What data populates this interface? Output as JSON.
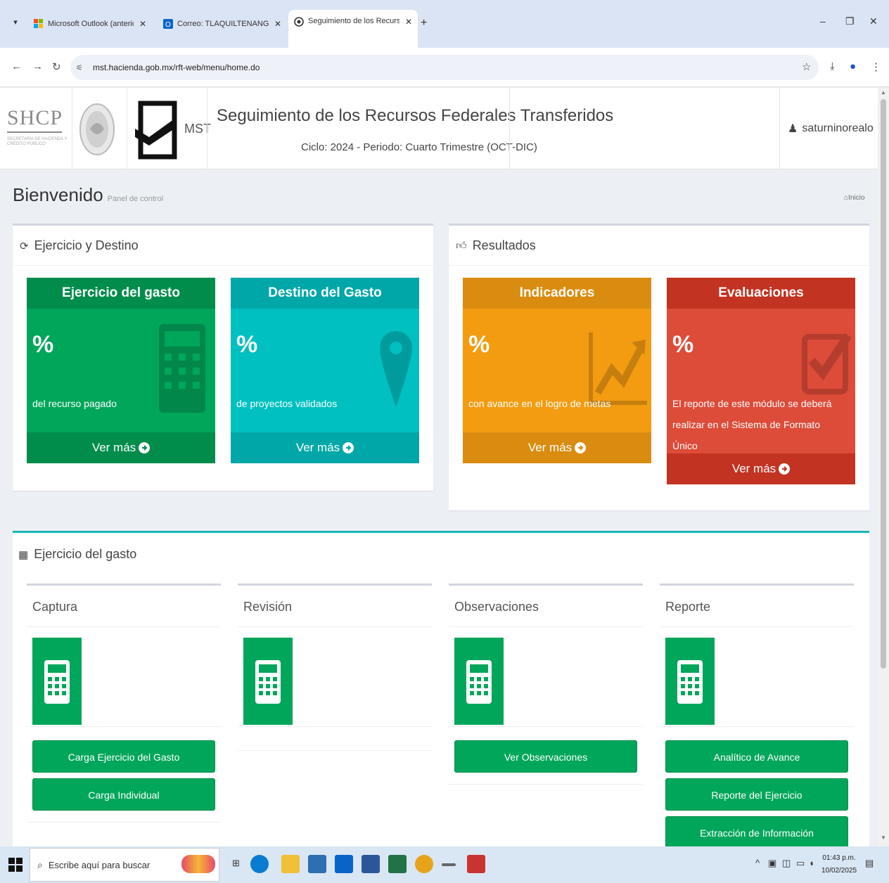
{
  "browser": {
    "tabs": [
      {
        "title": "Microsoft Outlook (anteriorme"
      },
      {
        "title": "Correo: TLAQUILTENANGO MC"
      },
      {
        "title": "Seguimiento de los Recursos F"
      }
    ],
    "url": "mst.hacienda.gob.mx/rft-web/menu/home.do"
  },
  "header": {
    "org_logo": "SHCP",
    "org_logo_sub": "SECRETARÍA DE HACIENDA Y CRÉDITO PÚBLICO",
    "mst_label": "MST",
    "title": "Seguimiento de los Recursos Federales Transferidos",
    "cycle": "Ciclo: 2024 - Periodo: Cuarto Trimestre (OCT-DIC)",
    "user": "saturninorealo"
  },
  "page": {
    "heading": "Bienvenido",
    "subheading": "Panel de control",
    "breadcrumb": "Inicio"
  },
  "box_left": {
    "title": "Ejercicio y Destino",
    "tiles": [
      {
        "title": "Ejercicio del gasto",
        "pct": "%",
        "desc": "del recurso pagado",
        "more": "Ver más",
        "color": "#00a65a",
        "dark": "#008d4c"
      },
      {
        "title": "Destino del Gasto",
        "pct": "%",
        "desc": "de proyectos validados",
        "more": "Ver más",
        "color": "#00c0c1",
        "dark": "#00a7a8"
      }
    ]
  },
  "box_right": {
    "title": "Resultados",
    "tiles": [
      {
        "title": "Indicadores",
        "pct": "%",
        "desc": "con avance en el logro de metas",
        "more": "Ver más",
        "color": "#f39c12",
        "dark": "#da8c10"
      },
      {
        "title": "Evaluaciones",
        "pct": "%",
        "desc": "El reporte de este módulo se deberá realizar en el Sistema de Formato Único",
        "more": "Ver más",
        "color": "#dd4b39",
        "dark": "#c23321"
      }
    ]
  },
  "section": {
    "title": "Ejercicio del gasto",
    "columns": [
      {
        "title": "Captura",
        "buttons": [
          "Carga Ejercicio del Gasto",
          "Carga Individual"
        ]
      },
      {
        "title": "Revisión",
        "buttons": []
      },
      {
        "title": "Observaciones",
        "buttons": [
          "Ver Observaciones"
        ]
      },
      {
        "title": "Reporte",
        "buttons": [
          "Analítico de Avance",
          "Reporte del Ejercicio",
          "Extracción de Información"
        ]
      }
    ]
  },
  "taskbar": {
    "search_placeholder": "Escribe aquí para buscar",
    "time": "01:43 p.m.",
    "date": "10/02/2025"
  },
  "icons": [
    "dropdown-icon",
    "outlook-icon",
    "mail-icon",
    "chrome-page-icon",
    "back-icon",
    "forward-icon",
    "reload-icon",
    "tune-icon",
    "star-icon",
    "download-icon",
    "profile-icon",
    "menu-icon",
    "user-icon",
    "home-icon",
    "refresh-icon",
    "thumbs-up-icon",
    "calculator-icon",
    "map-marker-icon",
    "chart-line-icon",
    "checkbox-icon",
    "arrow-circle-right-icon",
    "windows-icon",
    "search-icon"
  ]
}
